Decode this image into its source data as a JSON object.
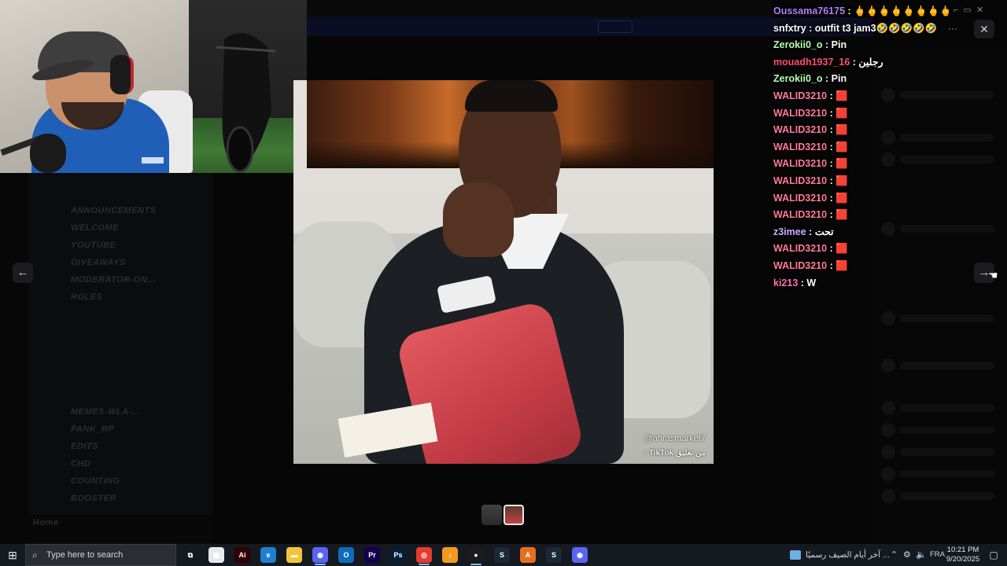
{
  "chat": [
    {
      "user": "Oussama76175",
      "color": "#b47cff",
      "msg": "🖕🖕🖕🖕🖕🖕🖕🖕"
    },
    {
      "user": "snfxtry",
      "color": "#ffffff",
      "msg": "outfit t3 jam3🤣🤣🤣🤣🤣"
    },
    {
      "user": "Zerokii0_o",
      "color": "#b4ffb0",
      "msg": "Pin"
    },
    {
      "user": "mouadh1937_16",
      "color": "#ff4d6d",
      "msg": "رجلين"
    },
    {
      "user": "Zerokii0_o",
      "color": "#b4ffb0",
      "msg": "Pin"
    },
    {
      "user": "WALID3210",
      "color": "#ff7a9a",
      "msg": "🟥"
    },
    {
      "user": "WALID3210",
      "color": "#ff7a9a",
      "msg": "🟥"
    },
    {
      "user": "WALID3210",
      "color": "#ff7a9a",
      "msg": "🟥"
    },
    {
      "user": "WALID3210",
      "color": "#ff7a9a",
      "msg": "🟥"
    },
    {
      "user": "WALID3210",
      "color": "#ff7a9a",
      "msg": "🟥"
    },
    {
      "user": "WALID3210",
      "color": "#ff7a9a",
      "msg": "🟥"
    },
    {
      "user": "WALID3210",
      "color": "#ff7a9a",
      "msg": "🟥"
    },
    {
      "user": "WALID3210",
      "color": "#ff7a9a",
      "msg": "🟥"
    },
    {
      "user": "z3imee",
      "color": "#c8b0ff",
      "msg": "تحت"
    },
    {
      "user": "WALID3210",
      "color": "#ff7a9a",
      "msg": "🟥"
    },
    {
      "user": "WALID3210",
      "color": "#ff7a9a",
      "msg": "🟥"
    },
    {
      "user": "ki213",
      "color": "#ff6eb0",
      "msg": "W"
    }
  ],
  "viewer": {
    "watermark": "@ahrasmarket7",
    "tiktok": "TikTok",
    "tiktok_ar": "من تعليق"
  },
  "nav": {
    "prev": "←",
    "next": "→",
    "close": "✕",
    "more": "···"
  },
  "background": {
    "channels": [
      "ANNOUNCEMENTS",
      "WELCOME",
      "YOUTUBE",
      "GIVEAWAYS",
      "MODERATOR-ON...",
      "ROLES",
      "MEMES-WLA-...",
      "PANK_RP",
      "EDITS",
      "CHD",
      "COUNTING",
      "BOOSTER"
    ],
    "user_name": "Home"
  },
  "taskbar": {
    "search_placeholder": "Type here to search",
    "news": "آخر أيام الصيف رسميًا ...",
    "lang": "FRA",
    "time": "10:21 PM",
    "date": "9/20/2025",
    "apps": [
      {
        "name": "task-view",
        "glyph": "⧉",
        "bg": "transparent"
      },
      {
        "name": "store",
        "glyph": "▦",
        "bg": "#e8e8e8"
      },
      {
        "name": "adobe-illustrator",
        "glyph": "Ai",
        "bg": "#330000"
      },
      {
        "name": "edge",
        "glyph": "e",
        "bg": "#1f7fd1"
      },
      {
        "name": "file-explorer",
        "glyph": "▬",
        "bg": "#f3c43a"
      },
      {
        "name": "discord",
        "glyph": "◉",
        "bg": "#5865f2"
      },
      {
        "name": "outlook",
        "glyph": "O",
        "bg": "#0f6cbd"
      },
      {
        "name": "premiere",
        "glyph": "Pr",
        "bg": "#14004d"
      },
      {
        "name": "photoshop",
        "glyph": "Ps",
        "bg": "#001e36"
      },
      {
        "name": "chrome",
        "glyph": "◎",
        "bg": "#e33b2e"
      },
      {
        "name": "fl-studio",
        "glyph": "♪",
        "bg": "#f39a1e"
      },
      {
        "name": "obs",
        "glyph": "●",
        "bg": "#1b1b1b"
      },
      {
        "name": "steam",
        "glyph": "S",
        "bg": "#1b2838"
      },
      {
        "name": "aimp",
        "glyph": "A",
        "bg": "#e3701d"
      },
      {
        "name": "steam-2",
        "glyph": "S",
        "bg": "#1b2838"
      },
      {
        "name": "discord-2",
        "glyph": "◉",
        "bg": "#5865f2"
      }
    ]
  }
}
